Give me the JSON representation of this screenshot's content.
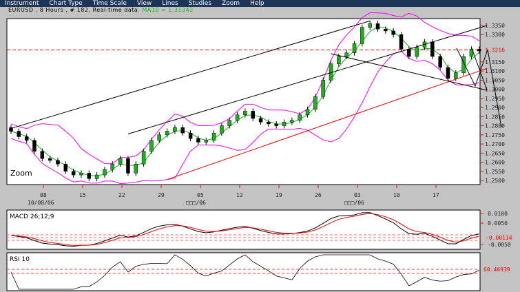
{
  "menu": [
    "Instrument",
    "Chart Type",
    "Time Scale",
    "View",
    "Lines",
    "Studies",
    "Zoom",
    "Help"
  ],
  "header": {
    "info": "EURUSD , 8 Hours , # 182, Real-time data",
    "ma": ", MA10 = 1.31342"
  },
  "zoom_label": "Zoom",
  "price_axis": {
    "ticks": [
      "1.3350",
      "1.3300",
      "1.3150",
      "1.3100",
      "1.3050",
      "1.3000",
      "1.2950",
      "1.2900",
      "1.2850",
      "1.2800",
      "1.2750",
      "1.2700",
      "1.2650",
      "1.2600",
      "1.2550",
      "1.2500"
    ],
    "last": "1.3216"
  },
  "date_axis": {
    "days": [
      "08",
      "15",
      "22",
      "29",
      "05",
      "12",
      "19",
      "26",
      "03",
      "10",
      "17"
    ],
    "months": [
      "10/08/06",
      "□□□/06",
      "□□□/06"
    ]
  },
  "macd": {
    "label": "MACD 26;12;9",
    "ticks": [
      "0.0100",
      "0.0050",
      "-0.0050"
    ],
    "last": "-0.00114"
  },
  "rsi": {
    "label": "RSI 10",
    "last": "60.46939"
  },
  "colors": {
    "menu_bg": "#1d3658",
    "ma": "#1bb21b",
    "bands": "#ff00ff",
    "up": "#1bb21b",
    "down": "#000000",
    "last": "#ff0000",
    "trend_red": "#ff0000"
  },
  "chart_data": {
    "type": "candlestick",
    "symbol": "EURUSD",
    "ylim": [
      1.25,
      1.335
    ],
    "closes": [
      1.277,
      1.274,
      1.272,
      1.266,
      1.262,
      1.261,
      1.259,
      1.255,
      1.253,
      1.254,
      1.251,
      1.253,
      1.256,
      1.259,
      1.262,
      1.254,
      1.259,
      1.266,
      1.272,
      1.275,
      1.277,
      1.279,
      1.276,
      1.273,
      1.271,
      1.272,
      1.276,
      1.28,
      1.283,
      1.286,
      1.288,
      1.284,
      1.282,
      1.281,
      1.28,
      1.282,
      1.283,
      1.286,
      1.289,
      1.296,
      1.305,
      1.314,
      1.318,
      1.32,
      1.325,
      1.334,
      1.336,
      1.333,
      1.332,
      1.33,
      1.322,
      1.318,
      1.323,
      1.326,
      1.318,
      1.312,
      1.306,
      1.309,
      1.318,
      1.322,
      1.321
    ],
    "trendlines": [
      {
        "color": "#000000",
        "from": [
          0,
          1.2785
        ],
        "to": [
          46,
          1.3375
        ]
      },
      {
        "color": "#000000",
        "from": [
          15,
          1.2755
        ],
        "to": [
          61,
          1.335
        ]
      },
      {
        "color": "#ff0000",
        "from": [
          20,
          1.2505
        ],
        "to": [
          61,
          1.3115
        ]
      },
      {
        "color": "#000000",
        "from": [
          41,
          1.3195
        ],
        "to": [
          61,
          1.2995
        ]
      },
      {
        "color": "#000000",
        "from": [
          59,
          1.323
        ],
        "to": [
          61,
          1.2995
        ]
      }
    ]
  }
}
